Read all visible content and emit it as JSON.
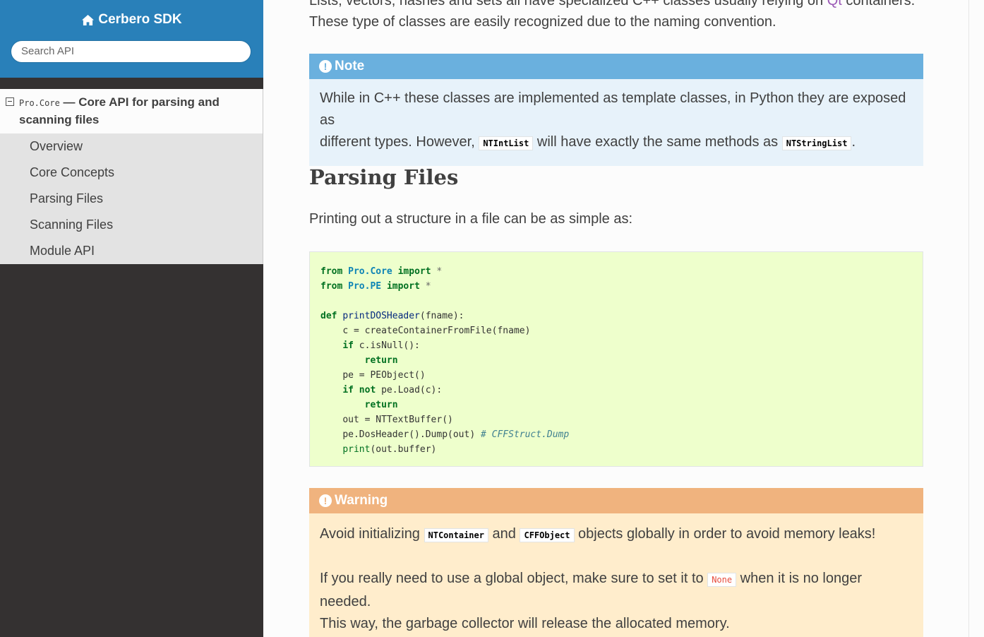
{
  "sidebar": {
    "brand": "Cerbero SDK",
    "search_placeholder": "Search API",
    "current": {
      "code": "Pro.Core",
      "dash": " — ",
      "title_line1": "Core API for parsing and",
      "title_line2": "scanning files"
    },
    "items": [
      {
        "label": "Overview"
      },
      {
        "label": "Core Concepts"
      },
      {
        "label": "Parsing Files"
      },
      {
        "label": "Scanning Files"
      },
      {
        "label": "Module API"
      }
    ]
  },
  "content": {
    "top_line1_before": "Lists, vectors, hashes and sets all have specialized C++ classes usually relying on ",
    "top_line1_link": "Qt",
    "top_line1_after": " containers.",
    "top_line2": "These type of classes are easily recognized due to the naming convention.",
    "note": {
      "title": "Note",
      "line1": "While in C++ these classes are implemented as template classes, in Python they are exposed as",
      "line2_before": "different types. However, ",
      "code1": "NTIntList",
      "line2_mid": " will have exactly the same methods as ",
      "code2": "NTStringList",
      "line2_after": "."
    },
    "section_title": "Parsing Files",
    "intro": "Printing out a structure in a file can be as simple as:",
    "code": {
      "from": "from",
      "import": "import",
      "mod1": "Pro.Core",
      "mod2": "Pro.PE",
      "star": "*",
      "def": "def",
      "fname_def": "printDOSHeader",
      "args": "(fname):",
      "l4": "c = createContainerFromFile(fname)",
      "if": "if",
      "l5": " c.isNull():",
      "return": "return",
      "l7": "pe = PEObject()",
      "not": "not",
      "l8": " pe.Load(c):",
      "l10": "out = NTTextBuffer()",
      "l11": "pe.DosHeader().Dump(out) ",
      "comment": "# CFFStruct.Dump",
      "print": "print",
      "l12": "(out.buffer)"
    },
    "warning": {
      "title": "Warning",
      "p1_before": "Avoid initializing ",
      "p1_code1": "NTContainer",
      "p1_mid": " and ",
      "p1_code2": "CFFObject",
      "p1_after": " objects globally in order to avoid memory leaks!",
      "p2_before": "If you really need to use a global object, make sure to set it to ",
      "p2_code": "None",
      "p2_after": " when it is no longer needed.",
      "p2_line2": "This way, the garbage collector will release the allocated memory."
    }
  },
  "colors": {
    "sidebar_top": "#2980b9",
    "note": "#6ab0de",
    "warning": "#f0b37e",
    "code_bg": "#eeffcc"
  }
}
